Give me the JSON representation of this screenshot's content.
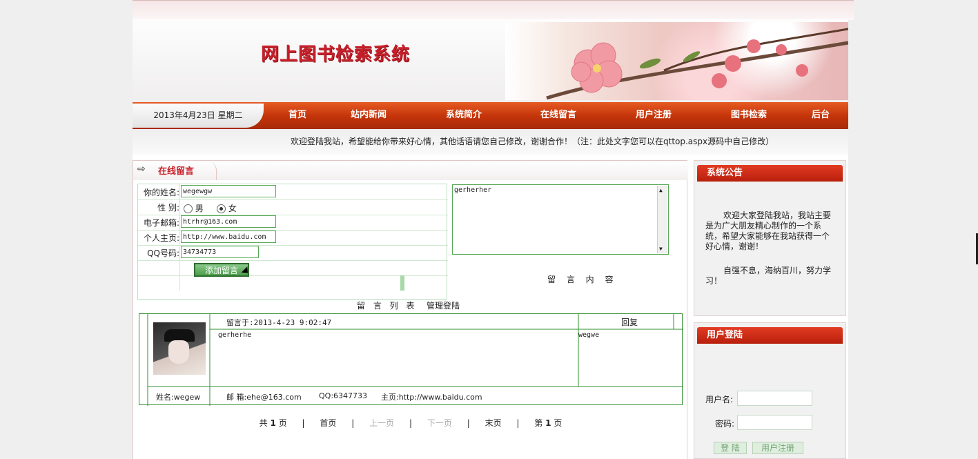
{
  "header": {
    "site_title": "网上图书检索系统",
    "date": "2013年4月23日 星期二",
    "nav": [
      "首页",
      "站内新闻",
      "系统简介",
      "在线留言",
      "用户注册",
      "图书检索",
      "后台"
    ],
    "welcome": "欢迎登陆我站，希望能给你带来好心情，其他话语请您自己修改，谢谢合作！（注：此处文字您可以在qttop.aspx源码中自己修改）"
  },
  "main": {
    "tab_title": "在线留言",
    "form": {
      "name_label": "你的姓名:",
      "name_value": "wegewgw",
      "gender_label": "性 别:",
      "gender_male": "男",
      "gender_female": "女",
      "gender_selected": "女",
      "email_label": "电子邮箱:",
      "email_value": "htrhr@163.com",
      "homepage_label": "个人主页:",
      "homepage_value": "http://www.baidu.com",
      "qq_label": "QQ号码:",
      "qq_value": "34734773",
      "add_button": "添加留言",
      "message_value": "gerherher",
      "message_label": "留 言 内 容"
    },
    "list_title": "留 言 列 表",
    "admin_login": "管理登陆",
    "entries": [
      {
        "posted_at": "留言于:2013-4-23 9:02:47",
        "reply_header": "回复",
        "content": "gerherhe",
        "reply": "wegwe",
        "name": "姓名:wegew",
        "email": "邮 箱:ehe@163.com",
        "qq": "QQ:6347733",
        "homepage": "主页:http://www.baidu.com"
      }
    ],
    "pager": {
      "total_prefix": "共",
      "total_pages": "1",
      "page_unit": "页",
      "first": "首页",
      "prev": "上一页",
      "next": "下一页",
      "last": "末页",
      "current_prefix": "第",
      "current": "1",
      "current_unit": "页"
    }
  },
  "sidebar": {
    "notice_title": "系统公告",
    "notice_p1": "欢迎大家登陆我站，我站主要是为广大朋友精心制作的一个系统，希望大家能够在我站获得一个好心情，谢谢！",
    "notice_p2": "自强不息，海纳百川，努力学习！",
    "login_title": "用户登陆",
    "username_label": "用户名:",
    "password_label": "密码:",
    "login_button": "登 陆",
    "register_button": "用户注册"
  },
  "colors": {
    "nav_red": "#c2330a",
    "title_red": "#c8202a",
    "border_green": "#2f8f2f"
  }
}
